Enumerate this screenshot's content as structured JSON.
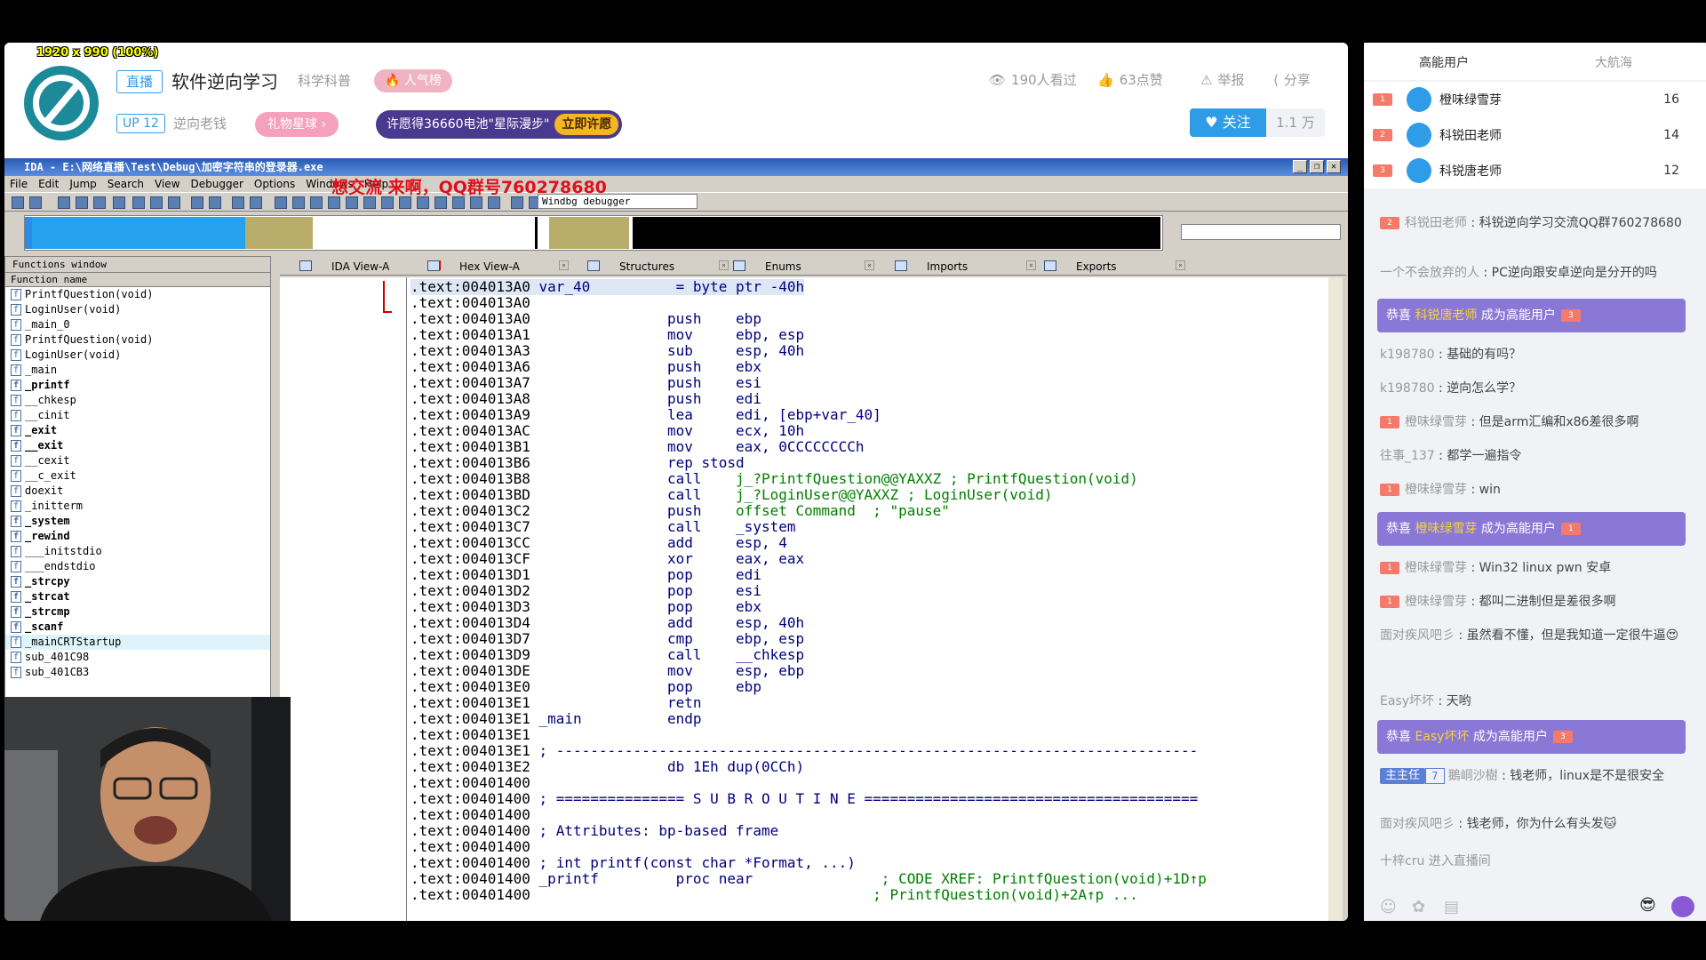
{
  "resolution_badge": "1920 x 990 (100%)",
  "header": {
    "live_tag": "直播",
    "title": "软件逆向学习",
    "category": "科学科普",
    "hot_tag": "人气榜",
    "up_tag": "UP 12",
    "up_name": "逆向老钱",
    "gift_pill": "礼物星球 ›",
    "wish_text": "许愿得36660电池\"星际漫步\"",
    "wish_btn": "立即许愿",
    "views": "190人看过",
    "likes": "63点赞",
    "report": "举报",
    "share": "分享",
    "follow": "关注",
    "followers": "1.1 万"
  },
  "ida": {
    "title": "IDA - E:\\网络直播\\Test\\Debug\\加密字符串的登录器.exe",
    "overlay": "想交流 来啊，QQ群号760278680",
    "menu": [
      "File",
      "Edit",
      "Jump",
      "Search",
      "View",
      "Debugger",
      "Options",
      "Windows",
      "Help"
    ],
    "debugger": "Windbg debugger",
    "functions_title": "Functions window",
    "function_col": "Function name",
    "functions": [
      {
        "name": "PrintfQuestion(void)",
        "bold": false,
        "sel": false
      },
      {
        "name": "LoginUser(void)",
        "bold": false,
        "sel": false
      },
      {
        "name": "_main_0",
        "bold": false,
        "sel": false
      },
      {
        "name": "PrintfQuestion(void)",
        "bold": false,
        "sel": false
      },
      {
        "name": "LoginUser(void)",
        "bold": false,
        "sel": false
      },
      {
        "name": "_main",
        "bold": false,
        "sel": false
      },
      {
        "name": "_printf",
        "bold": true,
        "sel": false
      },
      {
        "name": "__chkesp",
        "bold": false,
        "sel": false
      },
      {
        "name": "__cinit",
        "bold": false,
        "sel": false
      },
      {
        "name": "_exit",
        "bold": true,
        "sel": false
      },
      {
        "name": "__exit",
        "bold": true,
        "sel": false
      },
      {
        "name": "__cexit",
        "bold": false,
        "sel": false
      },
      {
        "name": "__c_exit",
        "bold": false,
        "sel": false
      },
      {
        "name": "doexit",
        "bold": false,
        "sel": false
      },
      {
        "name": "_initterm",
        "bold": false,
        "sel": false
      },
      {
        "name": "_system",
        "bold": true,
        "sel": false
      },
      {
        "name": "_rewind",
        "bold": true,
        "sel": false
      },
      {
        "name": "___initstdio",
        "bold": false,
        "sel": false
      },
      {
        "name": "___endstdio",
        "bold": false,
        "sel": false
      },
      {
        "name": "_strcpy",
        "bold": true,
        "sel": false
      },
      {
        "name": "_strcat",
        "bold": true,
        "sel": false
      },
      {
        "name": "_strcmp",
        "bold": true,
        "sel": false
      },
      {
        "name": "_scanf",
        "bold": true,
        "sel": false
      },
      {
        "name": "_mainCRTStartup",
        "bold": false,
        "sel": true
      },
      {
        "name": "sub_401C98",
        "bold": false,
        "sel": false
      },
      {
        "name": "sub_401CB3",
        "bold": false,
        "sel": false
      }
    ],
    "tabs": [
      "IDA View-A",
      "Hex View-A",
      "Structures",
      "Enums",
      "Imports",
      "Exports"
    ],
    "code": [
      [
        ".text:004013A0",
        " var_40",
        "          = byte ptr -40h",
        ""
      ],
      [
        ".text:004013A0",
        "",
        "",
        ""
      ],
      [
        ".text:004013A0",
        "",
        "                push    ",
        "ebp"
      ],
      [
        ".text:004013A1",
        "",
        "                mov     ",
        "ebp, esp"
      ],
      [
        ".text:004013A3",
        "",
        "                sub     ",
        "esp, 40h"
      ],
      [
        ".text:004013A6",
        "",
        "                push    ",
        "ebx"
      ],
      [
        ".text:004013A7",
        "",
        "                push    ",
        "esi"
      ],
      [
        ".text:004013A8",
        "",
        "                push    ",
        "edi"
      ],
      [
        ".text:004013A9",
        "",
        "                lea     ",
        "edi, [ebp+var_40]"
      ],
      [
        ".text:004013AC",
        "",
        "                mov     ",
        "ecx, 10h"
      ],
      [
        ".text:004013B1",
        "",
        "                mov     ",
        "eax, 0CCCCCCCCh"
      ],
      [
        ".text:004013B6",
        "",
        "                rep stosd",
        ""
      ],
      [
        ".text:004013B8",
        "",
        "                call    ",
        "j_?PrintfQuestion@@YAXXZ ; PrintfQuestion(void)"
      ],
      [
        ".text:004013BD",
        "",
        "                call    ",
        "j_?LoginUser@@YAXXZ ; LoginUser(void)"
      ],
      [
        ".text:004013C2",
        "",
        "                push    ",
        "offset Command  ; \"pause\""
      ],
      [
        ".text:004013C7",
        "",
        "                call    ",
        "_system"
      ],
      [
        ".text:004013CC",
        "",
        "                add     ",
        "esp, 4"
      ],
      [
        ".text:004013CF",
        "",
        "                xor     ",
        "eax, eax"
      ],
      [
        ".text:004013D1",
        "",
        "                pop     ",
        "edi"
      ],
      [
        ".text:004013D2",
        "",
        "                pop     ",
        "esi"
      ],
      [
        ".text:004013D3",
        "",
        "                pop     ",
        "ebx"
      ],
      [
        ".text:004013D4",
        "",
        "                add     ",
        "esp, 40h"
      ],
      [
        ".text:004013D7",
        "",
        "                cmp     ",
        "ebp, esp"
      ],
      [
        ".text:004013D9",
        "",
        "                call    ",
        "__chkesp"
      ],
      [
        ".text:004013DE",
        "",
        "                mov     ",
        "esp, ebp"
      ],
      [
        ".text:004013E0",
        "",
        "                pop     ",
        "ebp"
      ],
      [
        ".text:004013E1",
        "",
        "                retn",
        ""
      ],
      [
        ".text:004013E1",
        " _main",
        "          endp",
        ""
      ],
      [
        ".text:004013E1",
        "",
        "",
        ""
      ],
      [
        ".text:004013E1",
        " ; ---------------------------------------------------------------------------",
        "",
        ""
      ],
      [
        ".text:004013E2",
        "",
        "                db 1Eh dup(0CCh)",
        ""
      ],
      [
        ".text:00401400",
        "",
        "",
        ""
      ],
      [
        ".text:00401400",
        " ; =============== S U B R O U T I N E =======================================",
        "",
        ""
      ],
      [
        ".text:00401400",
        "",
        "",
        ""
      ],
      [
        ".text:00401400",
        " ; Attributes: bp-based frame",
        "",
        ""
      ],
      [
        ".text:00401400",
        "",
        "",
        ""
      ],
      [
        ".text:00401400",
        " ; int printf(const char *Format, ...)",
        "",
        ""
      ],
      [
        ".text:00401400",
        " _printf",
        "         proc near",
        "               ; CODE XREF: PrintfQuestion(void)+1D↑p"
      ],
      [
        ".text:00401400",
        "",
        "",
        "                                        ; PrintfQuestion(void)+2A↑p ..."
      ]
    ]
  },
  "chat": {
    "tab_high": "高能用户",
    "tab_voyage": "大航海",
    "ranking": [
      {
        "badge": "1",
        "name": "橙味绿雪芽",
        "value": "16"
      },
      {
        "badge": "2",
        "name": "科锐田老师",
        "value": "14"
      },
      {
        "badge": "3",
        "name": "科锐唐老师",
        "value": "12"
      }
    ],
    "messages": [
      {
        "kind": "msg",
        "badge": "2",
        "user": "科锐田老师",
        "text": "科锐逆向学习交流QQ群760278680"
      },
      {
        "kind": "msg",
        "badge": "",
        "user": "一个不会放弃的人",
        "text": "PC逆向跟安卓逆向是分开的吗"
      },
      {
        "kind": "congrats",
        "user": "科锐唐老师",
        "badge": "3",
        "pre": "恭喜",
        "post": "成为高能用户"
      },
      {
        "kind": "msg",
        "badge": "",
        "user": "k198780",
        "text": "基础的有吗？"
      },
      {
        "kind": "msg",
        "badge": "",
        "user": "k198780",
        "text": "逆向怎么学？"
      },
      {
        "kind": "msg",
        "badge": "1",
        "user": "橙味绿雪芽",
        "text": "但是arm汇编和x86差很多啊"
      },
      {
        "kind": "msg",
        "badge": "",
        "user": "往事_137",
        "text": "都学一遍指令"
      },
      {
        "kind": "msg",
        "badge": "1",
        "user": "橙味绿雪芽",
        "text": "win"
      },
      {
        "kind": "congrats",
        "user": "橙味绿雪芽",
        "badge": "1",
        "pre": "恭喜",
        "post": "成为高能用户"
      },
      {
        "kind": "msg",
        "badge": "1",
        "user": "橙味绿雪芽",
        "text": "Win32 linux pwn 安卓"
      },
      {
        "kind": "msg",
        "badge": "1",
        "user": "橙味绿雪芽",
        "text": "都叫二进制但是差很多啊"
      },
      {
        "kind": "msg",
        "badge": "",
        "user": "面对疾风吧彡",
        "text": "虽然看不懂，但是我知道一定很牛逼😍"
      },
      {
        "kind": "msg",
        "badge": "",
        "user": "Easy坏坏",
        "text": "天哟"
      },
      {
        "kind": "congrats",
        "user": "Easy坏坏",
        "badge": "3",
        "pre": "恭喜",
        "post": "成为高能用户"
      },
      {
        "kind": "role",
        "role": "主主任",
        "level": "7",
        "user": "鵝峒沙樹",
        "text": "钱老师，linux是不是很安全"
      },
      {
        "kind": "msg",
        "badge": "",
        "user": "面对疾风吧彡",
        "text": "钱老师，你为什么有头发🐱"
      },
      {
        "kind": "enter",
        "text": "十梓cru 进入直播间"
      }
    ]
  },
  "colors": {
    "accent": "#2f9ce7",
    "congrats": "#8a78d6",
    "badge": "#f47a6b"
  }
}
